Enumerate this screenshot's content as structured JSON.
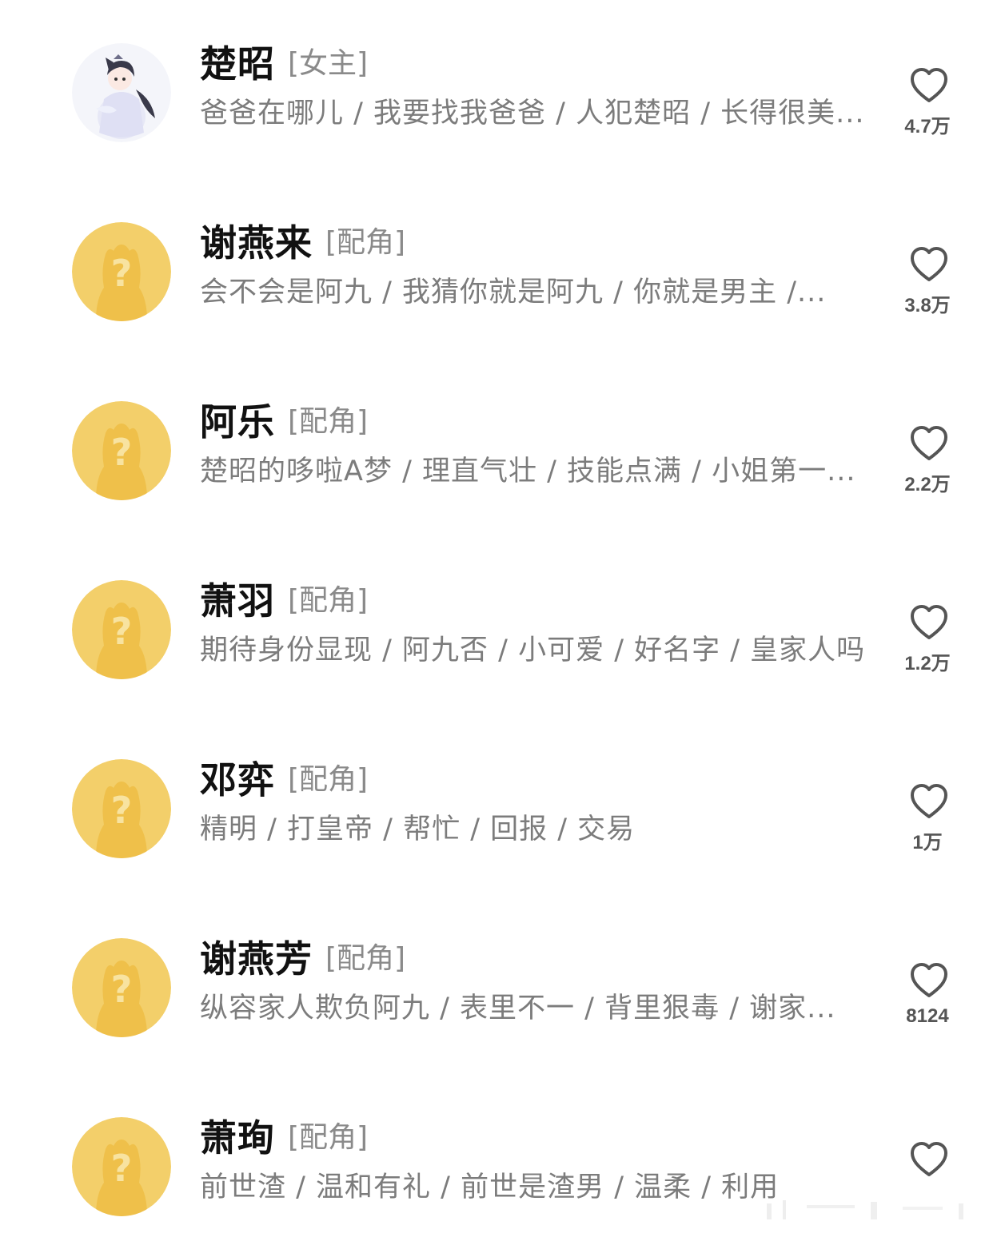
{
  "characters": [
    {
      "name": "楚昭",
      "role": "[女主]",
      "tags": "爸爸在哪儿 / 我要找我爸爸 / 人犯楚昭 / 长得很美...",
      "likes": "4.7万",
      "avatar_icon": "female-character-avatar-icon"
    },
    {
      "name": "谢燕来",
      "role": "[配角]",
      "tags": "会不会是阿九 / 我猜你就是阿九 / 你就是男主 /...",
      "likes": "3.8万",
      "avatar_icon": "unknown-character-avatar-icon"
    },
    {
      "name": "阿乐",
      "role": "[配角]",
      "tags": "楚昭的哆啦A梦 / 理直气壮 / 技能点满 / 小姐第一...",
      "likes": "2.2万",
      "avatar_icon": "unknown-character-avatar-icon"
    },
    {
      "name": "萧羽",
      "role": "[配角]",
      "tags": "期待身份显现 / 阿九否 / 小可爱 / 好名字 / 皇家人吗",
      "likes": "1.2万",
      "avatar_icon": "unknown-character-avatar-icon"
    },
    {
      "name": "邓弈",
      "role": "[配角]",
      "tags": "精明 / 打皇帝 / 帮忙 / 回报 / 交易",
      "likes": "1万",
      "avatar_icon": "unknown-character-avatar-icon"
    },
    {
      "name": "谢燕芳",
      "role": "[配角]",
      "tags": "纵容家人欺负阿九 / 表里不一 / 背里狠毒 / 谢家...",
      "likes": "8124",
      "avatar_icon": "unknown-character-avatar-icon"
    },
    {
      "name": "萧珣",
      "role": "[配角]",
      "tags": "前世渣 / 温和有礼 / 前世是渣男 / 温柔 / 利用",
      "likes": "",
      "avatar_icon": "unknown-character-avatar-icon"
    }
  ],
  "colors": {
    "name": "#111111",
    "role": "#8a8a8a",
    "tags": "#7c7c7c",
    "heart": "#555555",
    "avatar_gold": "#f3cf6a",
    "background": "#ffffff"
  },
  "icons": {
    "like": "heart-outline-icon"
  }
}
